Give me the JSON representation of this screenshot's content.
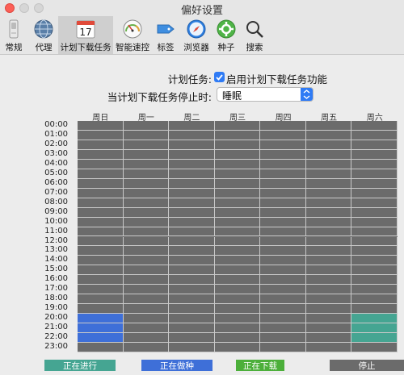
{
  "window": {
    "title": "偏好设置"
  },
  "toolbar": {
    "items": [
      {
        "label": "常规",
        "icon": "switch-icon"
      },
      {
        "label": "代理",
        "icon": "globe-icon"
      },
      {
        "label": "计划下载任务",
        "icon": "calendar-icon",
        "date": "17",
        "active": true
      },
      {
        "label": "智能速控",
        "icon": "speedometer-icon"
      },
      {
        "label": "标签",
        "icon": "tag-icon"
      },
      {
        "label": "浏览器",
        "icon": "compass-icon"
      },
      {
        "label": "种子",
        "icon": "gear-icon"
      },
      {
        "label": "搜索",
        "icon": "search-icon"
      }
    ]
  },
  "schedule": {
    "task_label": "计划任务:",
    "enable_label": "启用计划下载任务功能",
    "enabled": true,
    "stop_label": "当计划下载任务停止时:",
    "stop_value": "睡眠",
    "days": [
      "周日",
      "周一",
      "周二",
      "周三",
      "周四",
      "周五",
      "周六"
    ],
    "hours": [
      "00:00",
      "01:00",
      "02:00",
      "03:00",
      "04:00",
      "05:00",
      "06:00",
      "07:00",
      "08:00",
      "09:00",
      "10:00",
      "11:00",
      "12:00",
      "13:00",
      "14:00",
      "15:00",
      "16:00",
      "17:00",
      "18:00",
      "19:00",
      "20:00",
      "21:00",
      "22:00",
      "23:00"
    ],
    "state_colors": {
      "off": "#6b6b6b",
      "running": "#45a592",
      "seeding": "#3e6fd8",
      "downloading": "#4caf3a"
    },
    "cells": [
      {
        "day": 0,
        "hour": 20,
        "state": "seeding"
      },
      {
        "day": 0,
        "hour": 21,
        "state": "seeding"
      },
      {
        "day": 0,
        "hour": 22,
        "state": "seeding"
      },
      {
        "day": 6,
        "hour": 20,
        "state": "running"
      },
      {
        "day": 6,
        "hour": 21,
        "state": "running"
      },
      {
        "day": 6,
        "hour": 22,
        "state": "running"
      }
    ]
  },
  "legend": [
    {
      "label": "正在进行",
      "color": "#45a592"
    },
    {
      "label": "正在做种",
      "color": "#3e6fd8"
    },
    {
      "label": "正在下载",
      "color": "#4caf3a"
    },
    {
      "label": "停止",
      "color": "#6b6b6b"
    }
  ]
}
